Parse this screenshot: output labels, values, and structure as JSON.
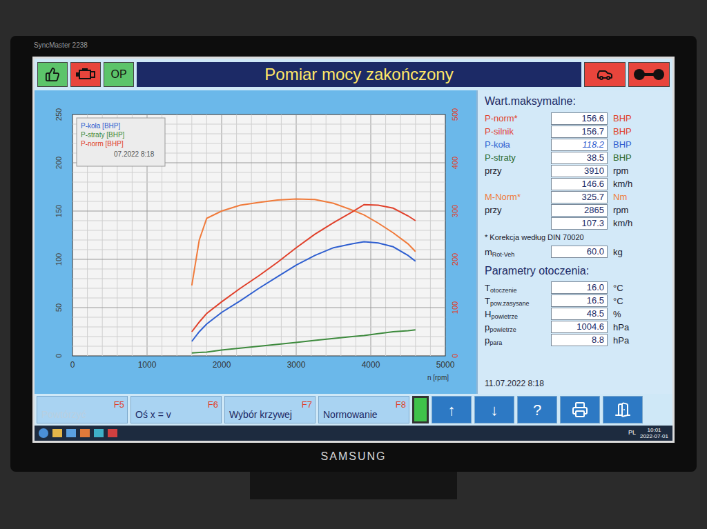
{
  "monitor": {
    "model": "SyncMaster 2238",
    "brand": "SAMSUNG"
  },
  "header": {
    "title": "Pomiar mocy zakończony",
    "left_buttons": [
      {
        "kind": "thumb",
        "label": "",
        "color": "#5cc46a"
      },
      {
        "kind": "engine",
        "label": "",
        "color": "#e8453c"
      },
      {
        "kind": "text",
        "label": "OP",
        "color": "#5cc46a"
      }
    ],
    "right_buttons": [
      {
        "kind": "car"
      },
      {
        "kind": "rollers"
      }
    ]
  },
  "chart": {
    "legend": [
      {
        "label": "P-koła [BHP]",
        "color": "#2f5fd0"
      },
      {
        "label": "P-straty [BHP]",
        "color": "#3d8a3d"
      },
      {
        "label": "P-norm [BHP]",
        "color": "#e0402a"
      }
    ],
    "legend_date": "07.2022 8:18",
    "y_ticks": [
      "0",
      "50",
      "100",
      "150",
      "200",
      "250"
    ],
    "y2_ticks": [
      "0",
      "100",
      "200",
      "300",
      "400",
      "500"
    ],
    "x_ticks": [
      "0",
      "1000",
      "2000",
      "3000",
      "4000",
      "5000"
    ],
    "x_label": "n [rpm]",
    "rpm": [
      1600,
      1700,
      1800,
      2000,
      2250,
      2500,
      2750,
      3000,
      3250,
      3500,
      3750,
      3910,
      4100,
      4300,
      4500,
      4600
    ],
    "series": [
      {
        "color": "#f07a3a",
        "axis": "right",
        "values": [
          146,
          240,
          285,
          300,
          312,
          318,
          323,
          325,
          324,
          316,
          302,
          292,
          275,
          255,
          232,
          216
        ]
      },
      {
        "color": "#e0402a",
        "axis": "left",
        "values": [
          25,
          35,
          44,
          56,
          70,
          83,
          97,
          112,
          126,
          138,
          149,
          156.6,
          156,
          153,
          145,
          140
        ]
      },
      {
        "color": "#2f5fd0",
        "axis": "left",
        "values": [
          15,
          25,
          33,
          45,
          57,
          70,
          82,
          94,
          104,
          112,
          116,
          118.2,
          117,
          113,
          104,
          98
        ]
      },
      {
        "color": "#3d8a3d",
        "axis": "left",
        "values": [
          3,
          3.5,
          4,
          6,
          8,
          10,
          12,
          14,
          16,
          18,
          20,
          21,
          23,
          25,
          26,
          27
        ]
      }
    ]
  },
  "max": {
    "title": "Wart.maksymalne:",
    "rows": [
      {
        "label": "P-norm*",
        "value": "156.6",
        "unit": "BHP",
        "color": "#e0402a"
      },
      {
        "label": "P-silnik",
        "value": "156.7",
        "unit": "BHP",
        "color": "#e0402a"
      },
      {
        "label": "P-koła",
        "value": "118.2",
        "unit": "BHP",
        "color": "#2f5fd0"
      },
      {
        "label": "P-straty",
        "value": "38.5",
        "unit": "BHP",
        "color": "#2e6b2e"
      },
      {
        "label": "przy",
        "value": "3910",
        "unit": "rpm",
        "color": "#1a1a2e"
      },
      {
        "label": "",
        "value": "146.6",
        "unit": "km/h",
        "color": "#1a1a2e"
      },
      {
        "label": "M-Norm*",
        "value": "325.7",
        "unit": "Nm",
        "color": "#f07a3a"
      },
      {
        "label": "przy",
        "value": "2865",
        "unit": "rpm",
        "color": "#1a1a2e"
      },
      {
        "label": "",
        "value": "107.3",
        "unit": "km/h",
        "color": "#1a1a2e"
      }
    ],
    "note": "* Korekcja według DIN 70020",
    "mass": {
      "label": "m",
      "sub": "Rot-Veh",
      "value": "60.0",
      "unit": "kg"
    }
  },
  "env": {
    "title": "Parametry otoczenia:",
    "rows": [
      {
        "label": "T",
        "sub": "otoczenie",
        "value": "16.0",
        "unit": "°C"
      },
      {
        "label": "T",
        "sub": "pow.zasysane",
        "value": "16.5",
        "unit": "°C"
      },
      {
        "label": "H",
        "sub": "powietrze",
        "value": "48.5",
        "unit": "%"
      },
      {
        "label": "p",
        "sub": "powietrze",
        "value": "1004.6",
        "unit": "hPa"
      },
      {
        "label": "p",
        "sub": "para",
        "value": "8.8",
        "unit": "hPa"
      }
    ],
    "date": "11.07.2022 8:18"
  },
  "toolbar": {
    "buttons": [
      {
        "label": "Powtórzyć",
        "key": "F5",
        "disabled": true
      },
      {
        "label": "Oś x = v",
        "key": "F6",
        "disabled": false
      },
      {
        "label": "Wybór krzywej",
        "key": "F7",
        "disabled": false
      },
      {
        "label": "Normowanie",
        "key": "F8",
        "disabled": false
      }
    ],
    "indicator": {
      "level": 1
    },
    "icon_buttons": [
      {
        "kind": "text",
        "label": "↑"
      },
      {
        "kind": "text",
        "label": "↓"
      },
      {
        "kind": "text",
        "label": "?"
      },
      {
        "kind": "printer",
        "label": ""
      },
      {
        "kind": "exit",
        "label": ""
      }
    ]
  },
  "taskbar": {
    "lang": "PL",
    "time": "10:01",
    "date": "2022-07-01"
  }
}
